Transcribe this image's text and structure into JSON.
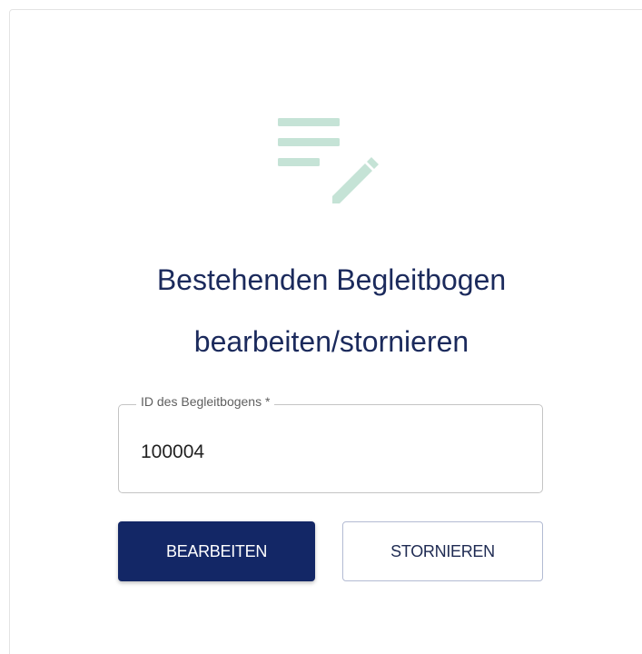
{
  "form": {
    "title_line1": "Bestehenden Begleitbogen",
    "title_line2": "bearbeiten/stornieren",
    "icon": "edit-note-icon",
    "accent_color": "#c5e3d6",
    "field": {
      "label": "ID des Begleitbogens *",
      "value": "100004"
    },
    "buttons": {
      "edit_label": "BEARBEITEN",
      "cancel_label": "STORNIEREN"
    },
    "primary_color": "#132766",
    "title_color": "#1b2a5c"
  }
}
